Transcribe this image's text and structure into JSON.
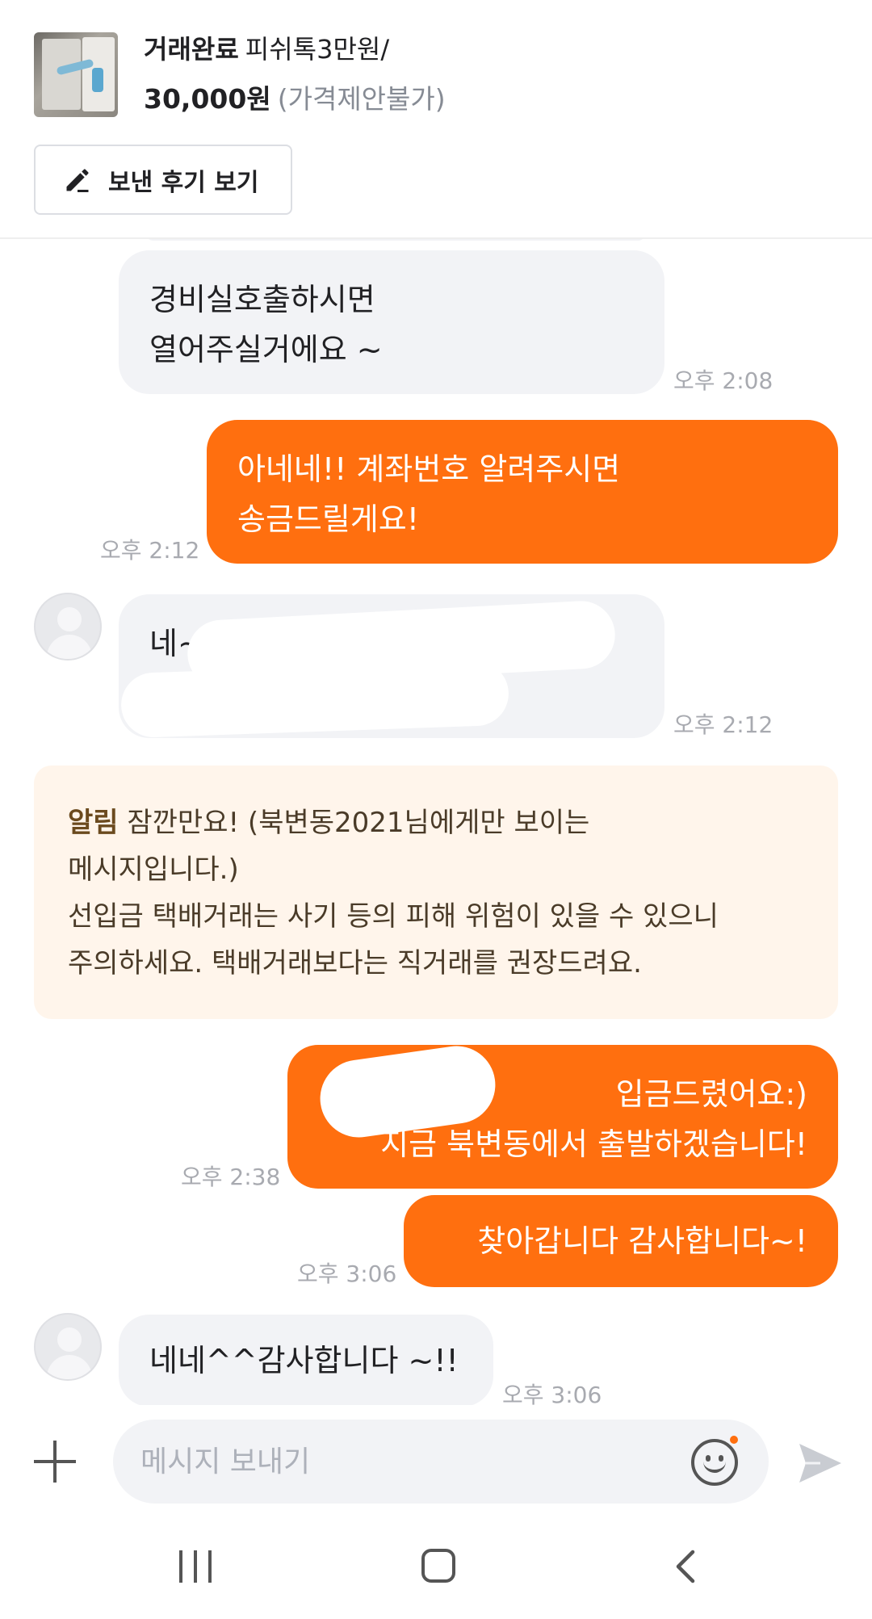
{
  "header": {
    "status": "거래완료",
    "item_name": "피쉬톡3만원/",
    "price": "30,000원",
    "price_note": "(가격제안불가)",
    "review_button": "보낸 후기 보기"
  },
  "messages": [
    {
      "side": "in",
      "lines": [
        "경비실호출하시면",
        "열어주실거에요 ~"
      ],
      "time": "오후 2:08"
    },
    {
      "side": "out",
      "lines": [
        "아네네!! 계좌번호 알려주시면",
        "송금드릴게요!"
      ],
      "time": "오후 2:12"
    },
    {
      "side": "in",
      "lines": [
        "네~"
      ],
      "time": "오후 2:12"
    },
    {
      "side": "out",
      "lines": [
        "입금드렸어요:)",
        "지금 북변동에서 출발하겠습니다!"
      ],
      "time": "오후 2:38"
    },
    {
      "side": "out",
      "lines": [
        "찾아갑니다 감사합니다~!"
      ],
      "time": "오후 3:06"
    },
    {
      "side": "in",
      "lines": [
        "네네^^감사합니다 ~!!"
      ],
      "time": "오후 3:06"
    }
  ],
  "notice": {
    "label": "알림",
    "line1": " 잠깐만요! (북변동2021님에게만 보이는",
    "line2": "메시지입니다.)",
    "line3": "선입금 택배거래는 사기 등의 피해 위험이 있을 수 있으니",
    "line4": "주의하세요. 택배거래보다는 직거래를 권장드려요."
  },
  "input": {
    "placeholder": "메시지 보내기"
  },
  "colors": {
    "accent": "#ff6f0f",
    "incoming_bubble": "#f2f3f6",
    "notice_bg": "#fff5eb"
  },
  "icons": [
    "pencil-icon",
    "plus-icon",
    "emoji-icon",
    "send-icon",
    "recent-apps-icon",
    "home-icon",
    "back-icon"
  ]
}
